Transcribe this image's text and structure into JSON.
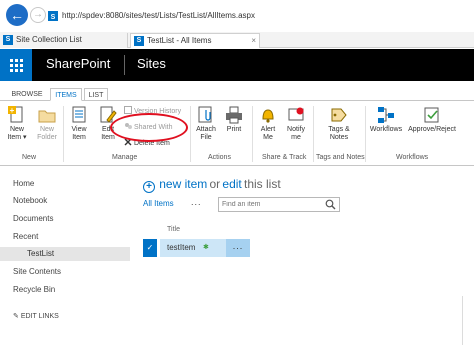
{
  "browser": {
    "url": "http://spdev:8080/sites/test/Lists/TestList/AllItems.aspx",
    "tabs": [
      {
        "label": "Site Collection List"
      },
      {
        "label": "TestList - All Items"
      }
    ],
    "close_glyph": "×"
  },
  "suite_bar": {
    "brand": "SharePoint",
    "sites": "Sites"
  },
  "ribbon": {
    "tabs": [
      "BROWSE",
      "ITEMS",
      "LIST"
    ],
    "active_tab": "ITEMS",
    "buttons": {
      "new_item": "New Item",
      "new_item_caret": "▾",
      "new_folder": "New Folder",
      "view_item": "View Item",
      "edit_item": "Edit Item",
      "version_history": "Version History",
      "shared_with": "Shared With",
      "delete_item": "Delete Item",
      "attach_file": "Attach File",
      "print": "Print",
      "alert_me": "Alert Me",
      "notify_me": "Notify me",
      "tags_notes": "Tags & Notes",
      "workflows": "Workflows",
      "approve_reject": "Approve/Reject"
    },
    "groups": {
      "new": "New",
      "manage": "Manage",
      "actions": "Actions",
      "share_track": "Share & Track",
      "tags_and_notes": "Tags and Notes",
      "workflows": "Workflows"
    },
    "highlight_color": "#e01020"
  },
  "left_nav": {
    "items": [
      "Home",
      "Notebook",
      "Documents",
      "Recent",
      "TestList",
      "Site Contents",
      "Recycle Bin"
    ],
    "selected": "TestList",
    "edit_links": "EDIT LINKS"
  },
  "main": {
    "new_item": "new item",
    "or": "or",
    "edit": "edit",
    "this_list": "this list",
    "view_label": "All Items",
    "view_ellipsis": "...",
    "search_placeholder": "Find an item",
    "column_title": "Title",
    "rows": [
      {
        "title": "testItem",
        "is_new": true
      }
    ],
    "row_menu": "...",
    "check_glyph": "✓",
    "new_glyph": "✱"
  },
  "colors": {
    "accent": "#0072c6",
    "suite_bar": "#000000",
    "selected_row": "#cde6f7"
  }
}
